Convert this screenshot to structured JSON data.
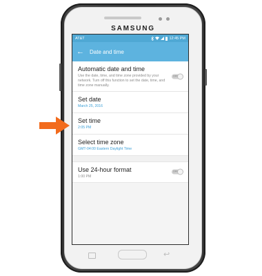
{
  "device": {
    "brand": "SAMSUNG"
  },
  "status_bar": {
    "carrier": "AT&T",
    "time": "12:45 PM"
  },
  "app_bar": {
    "title": "Date and time"
  },
  "settings": [
    {
      "title": "Automatic date and time",
      "subtitle": "Use the date, time, and time zone provided by your network. Turn off this function to set the date, time, and time zone manually.",
      "toggle": "OFF"
    },
    {
      "title": "Set date",
      "subtitle": "March 25, 2016"
    },
    {
      "title": "Set time",
      "subtitle": "2:05 PM"
    },
    {
      "title": "Select time zone",
      "subtitle": "GMT-04:00 Eastern Daylight Time"
    },
    {
      "title": "Use 24-hour format",
      "subtitle": "1:00 PM",
      "toggle": "OFF"
    }
  ],
  "annotation": {
    "arrow_color": "#f26b1d",
    "pointing_to": "Set time"
  },
  "colors": {
    "status_bar": "#4fa8d4",
    "app_bar": "#5db3df",
    "link_blue": "#3a9ed6"
  }
}
